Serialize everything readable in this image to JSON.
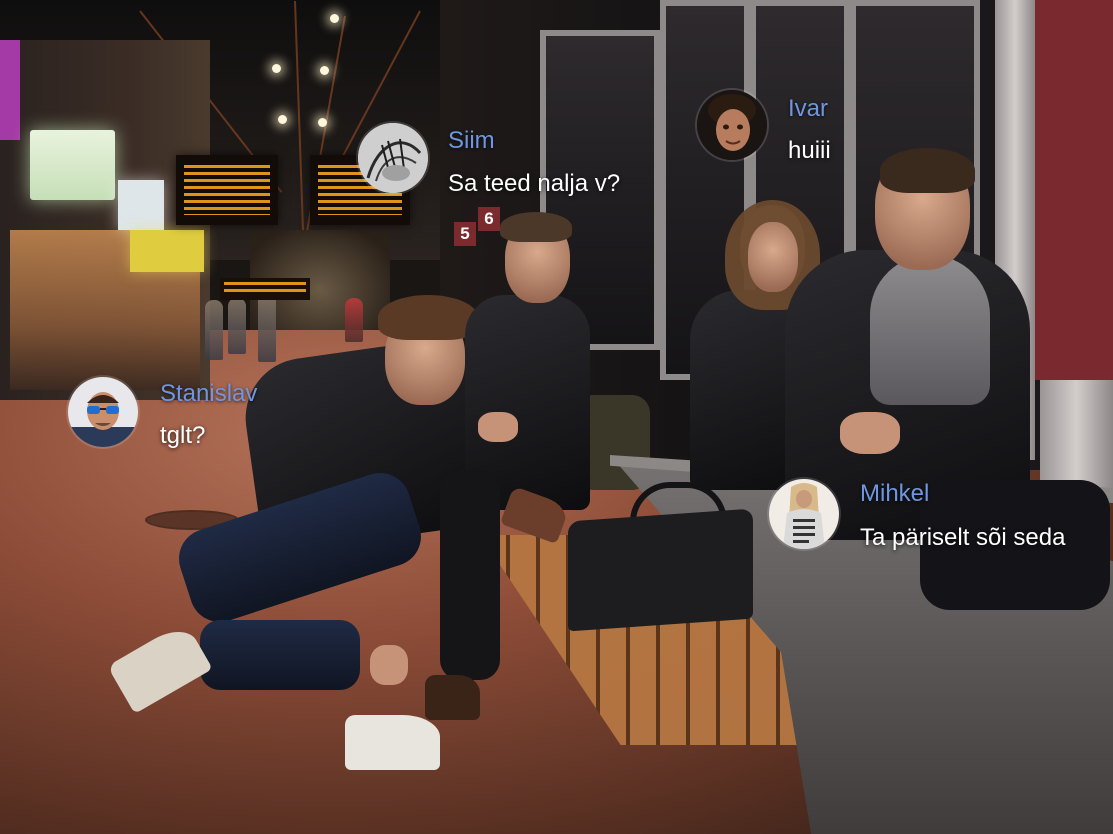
{
  "chat_messages": [
    {
      "name": "Siim",
      "message": "Sa teed nalja v?",
      "avatar_icon": "sketch-avatar-icon"
    },
    {
      "name": "Ivar",
      "message": "huiii",
      "avatar_icon": "face-avatar-icon"
    },
    {
      "name": "Stanislav",
      "message": "tglt?",
      "avatar_icon": "sunglasses-avatar-icon"
    },
    {
      "name": "Mihkel",
      "message": "Ta päriselt sõi seda",
      "avatar_icon": "shirt-avatar-icon"
    }
  ],
  "scene": {
    "platform_numbers": [
      "5",
      "6"
    ],
    "colors": {
      "name_blue": "#6f96e0",
      "message_white": "#ffffff",
      "departure_board_amber": "#f2a31c",
      "floor_terracotta": "#8e4d38"
    }
  }
}
